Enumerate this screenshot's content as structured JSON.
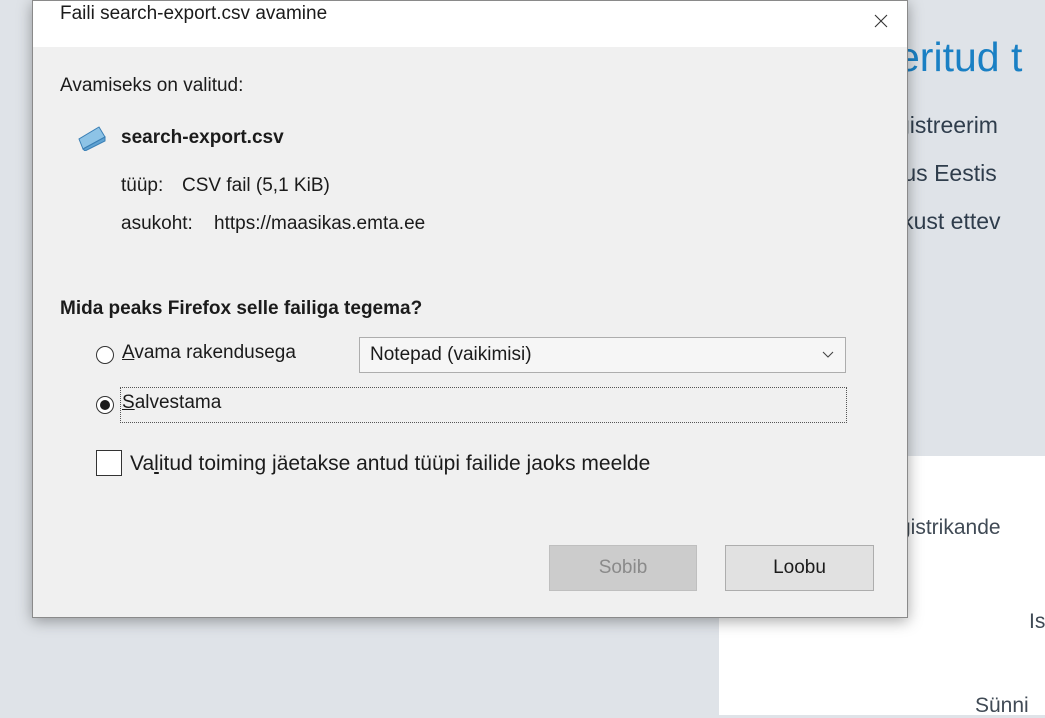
{
  "background_page": {
    "heading": "eritud t",
    "lines": [
      "gistreerim",
      "tus Eestis",
      "ikust ettev"
    ],
    "content_lines": [
      "gistrikande",
      "Is",
      "Sünni"
    ]
  },
  "dialog": {
    "title": "Faili search-export.csv avamine",
    "opening_label": "Avamiseks on valitud:",
    "file_name": "search-export.csv",
    "type_label": "tüüp:",
    "type_value": "CSV fail (5,1 KiB)",
    "location_label": "asukoht:",
    "location_value": "https://maasikas.emta.ee",
    "question": "Mida peaks Firefox selle failiga tegema?",
    "open_with": {
      "accel": "A",
      "rest": "vama rakendusega",
      "selected": false
    },
    "app_select": {
      "value": "Notepad (vaikimisi)"
    },
    "save": {
      "accel": "S",
      "rest": "alvestama",
      "selected": true
    },
    "remember": {
      "before": "Va",
      "accel": "l",
      "after": "itud toiming jäetakse antud tüüpi failide jaoks meelde",
      "checked": false
    },
    "ok_label": "Sobib",
    "cancel_label": "Loobu"
  },
  "colors": {
    "accent": "#1a80c4",
    "page_bg": "#dfe3e8",
    "dialog_bg": "#f0f0f0"
  }
}
